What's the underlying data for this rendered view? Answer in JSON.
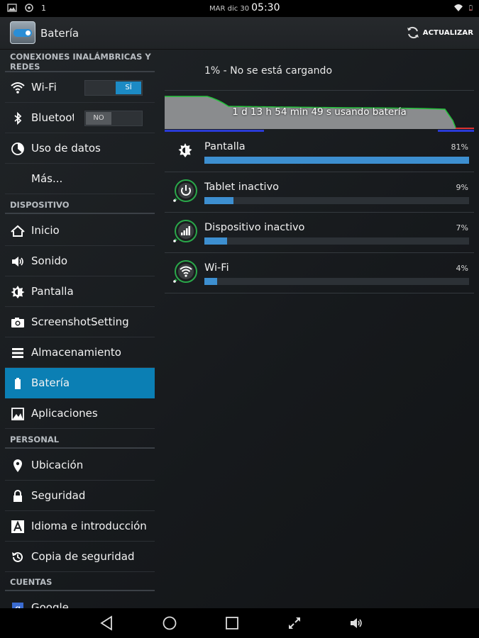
{
  "status_bar": {
    "notification_count": "1",
    "date": "MAR dic 30",
    "time": "05:30"
  },
  "action_bar": {
    "title": "Batería",
    "refresh_label": "ACTUALIZAR"
  },
  "sidebar": {
    "sections": [
      {
        "header": "CONEXIONES INALÁMBRICAS Y REDES",
        "items": [
          {
            "label": "Wi-Fi",
            "icon": "wifi-icon",
            "switch": "SÍ"
          },
          {
            "label": "Bluetooth",
            "icon": "bluetooth-icon",
            "switch": "NO"
          },
          {
            "label": "Uso de datos",
            "icon": "data-usage-icon"
          },
          {
            "label": "Más...",
            "icon": ""
          }
        ]
      },
      {
        "header": "DISPOSITIVO",
        "items": [
          {
            "label": "Inicio",
            "icon": "home-icon"
          },
          {
            "label": "Sonido",
            "icon": "speaker-icon"
          },
          {
            "label": "Pantalla",
            "icon": "brightness-icon"
          },
          {
            "label": "ScreenshotSetting",
            "icon": "camera-icon"
          },
          {
            "label": "Almacenamiento",
            "icon": "storage-icon"
          },
          {
            "label": "Batería",
            "icon": "battery-icon",
            "selected": true
          },
          {
            "label": "Aplicaciones",
            "icon": "apps-icon"
          }
        ]
      },
      {
        "header": "PERSONAL",
        "items": [
          {
            "label": "Ubicación",
            "icon": "location-icon"
          },
          {
            "label": "Seguridad",
            "icon": "lock-icon"
          },
          {
            "label": "Idioma e introducción",
            "icon": "language-icon"
          },
          {
            "label": "Copia de seguridad",
            "icon": "backup-icon"
          }
        ]
      },
      {
        "header": "CUENTAS",
        "items": [
          {
            "label": "Google",
            "icon": "google-icon"
          }
        ]
      }
    ]
  },
  "battery": {
    "status": "1% - No se está cargando",
    "graph_label": "1 d 13 h 54 min 49 s usando batería",
    "graph_line_color": "#22c43a",
    "bar_color": "#3d8fd0",
    "usage": [
      {
        "name": "Pantalla",
        "percent": 81,
        "percent_label": "81%",
        "icon": "brightness-icon"
      },
      {
        "name": "Tablet inactivo",
        "percent": 9,
        "percent_label": "9%",
        "icon": "power-icon"
      },
      {
        "name": "Dispositivo inactivo",
        "percent": 7,
        "percent_label": "7%",
        "icon": "signal-icon"
      },
      {
        "name": "Wi-Fi",
        "percent": 4,
        "percent_label": "4%",
        "icon": "wifi-icon"
      }
    ]
  },
  "nav_bar": {
    "buttons": [
      "back-icon",
      "home-icon",
      "recents-icon",
      "expand-icon",
      "volume-icon"
    ]
  }
}
